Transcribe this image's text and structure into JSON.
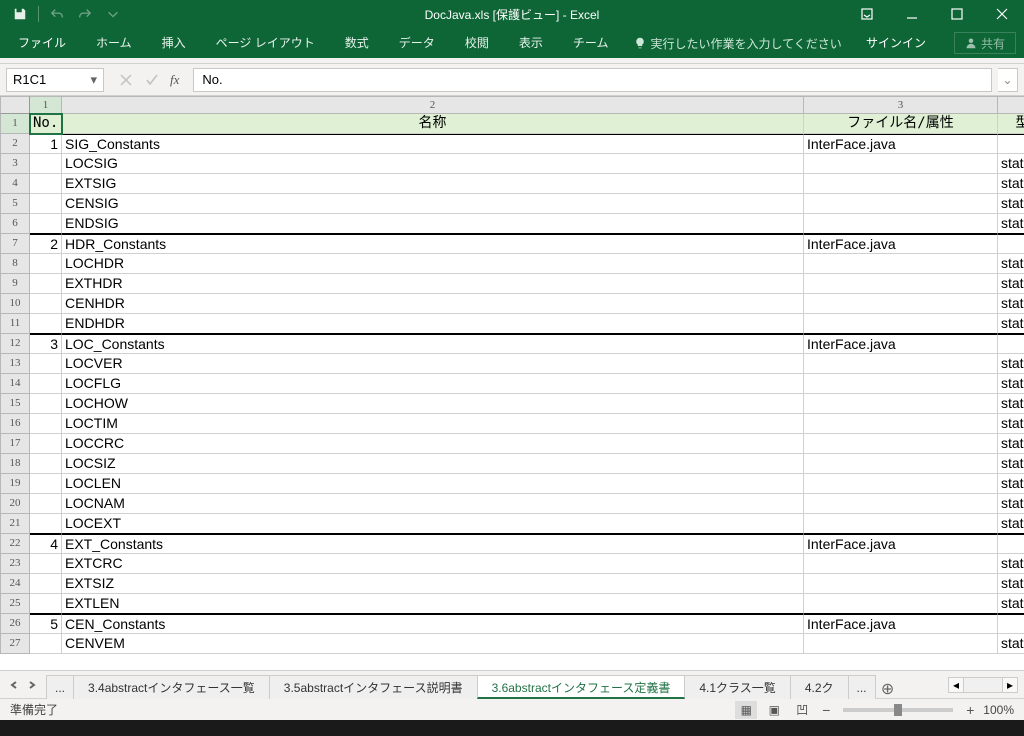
{
  "title": "DocJava.xls  [保護ビュー] - Excel",
  "qat": {
    "undo": "↶",
    "redo": "↷"
  },
  "ribbon": {
    "tabs": [
      "ファイル",
      "ホーム",
      "挿入",
      "ページ レイアウト",
      "数式",
      "データ",
      "校閲",
      "表示",
      "チーム"
    ],
    "tell_me": "実行したい作業を入力してください",
    "signin": "サインイン",
    "share": "共有"
  },
  "namebox": "R1C1",
  "formula": "No.",
  "columns": [
    "1",
    "2",
    "3"
  ],
  "headers": {
    "c1": "No.",
    "c2": "名称",
    "c3": "ファイル名/属性",
    "c4": "型"
  },
  "rows": [
    {
      "no": "1",
      "name": "SIG_Constants",
      "file": "InterFace.java",
      "attr": "",
      "sec": true
    },
    {
      "no": "",
      "name": "LOCSIG",
      "file": "",
      "attr": "stati"
    },
    {
      "no": "",
      "name": "EXTSIG",
      "file": "",
      "attr": "stati"
    },
    {
      "no": "",
      "name": "CENSIG",
      "file": "",
      "attr": "stati"
    },
    {
      "no": "",
      "name": "ENDSIG",
      "file": "",
      "attr": "stati",
      "bb": true
    },
    {
      "no": "2",
      "name": "HDR_Constants",
      "file": "InterFace.java",
      "attr": "",
      "sec": true
    },
    {
      "no": "",
      "name": "LOCHDR",
      "file": "",
      "attr": "stati"
    },
    {
      "no": "",
      "name": "EXTHDR",
      "file": "",
      "attr": "stati"
    },
    {
      "no": "",
      "name": "CENHDR",
      "file": "",
      "attr": "stati"
    },
    {
      "no": "",
      "name": "ENDHDR",
      "file": "",
      "attr": "stati",
      "bb": true
    },
    {
      "no": "3",
      "name": "LOC_Constants",
      "file": "InterFace.java",
      "attr": "",
      "sec": true
    },
    {
      "no": "",
      "name": "LOCVER",
      "file": "",
      "attr": "stati"
    },
    {
      "no": "",
      "name": "LOCFLG",
      "file": "",
      "attr": "stati"
    },
    {
      "no": "",
      "name": "LOCHOW",
      "file": "",
      "attr": "stati"
    },
    {
      "no": "",
      "name": "LOCTIM",
      "file": "",
      "attr": "stati"
    },
    {
      "no": "",
      "name": "LOCCRC",
      "file": "",
      "attr": "stati"
    },
    {
      "no": "",
      "name": "LOCSIZ",
      "file": "",
      "attr": "stati"
    },
    {
      "no": "",
      "name": "LOCLEN",
      "file": "",
      "attr": "stati"
    },
    {
      "no": "",
      "name": "LOCNAM",
      "file": "",
      "attr": "stati"
    },
    {
      "no": "",
      "name": "LOCEXT",
      "file": "",
      "attr": "stati",
      "bb": true
    },
    {
      "no": "4",
      "name": "EXT_Constants",
      "file": "InterFace.java",
      "attr": "",
      "sec": true
    },
    {
      "no": "",
      "name": "EXTCRC",
      "file": "",
      "attr": "stati"
    },
    {
      "no": "",
      "name": "EXTSIZ",
      "file": "",
      "attr": "stati"
    },
    {
      "no": "",
      "name": "EXTLEN",
      "file": "",
      "attr": "stati",
      "bb": true
    },
    {
      "no": "5",
      "name": "CEN_Constants",
      "file": "InterFace.java",
      "attr": "",
      "sec": true
    },
    {
      "no": "",
      "name": "CENVEM",
      "file": "",
      "attr": "stati"
    }
  ],
  "sheet_tabs": {
    "ell": "...",
    "items": [
      "3.4abstractインタフェース一覧",
      "3.5abstractインタフェース説明書",
      "3.6abstractインタフェース定義書",
      "4.1クラス一覧",
      "4.2ク"
    ],
    "active": 2,
    "more": "..."
  },
  "status": {
    "ready": "準備完了",
    "zoom": "100%"
  }
}
